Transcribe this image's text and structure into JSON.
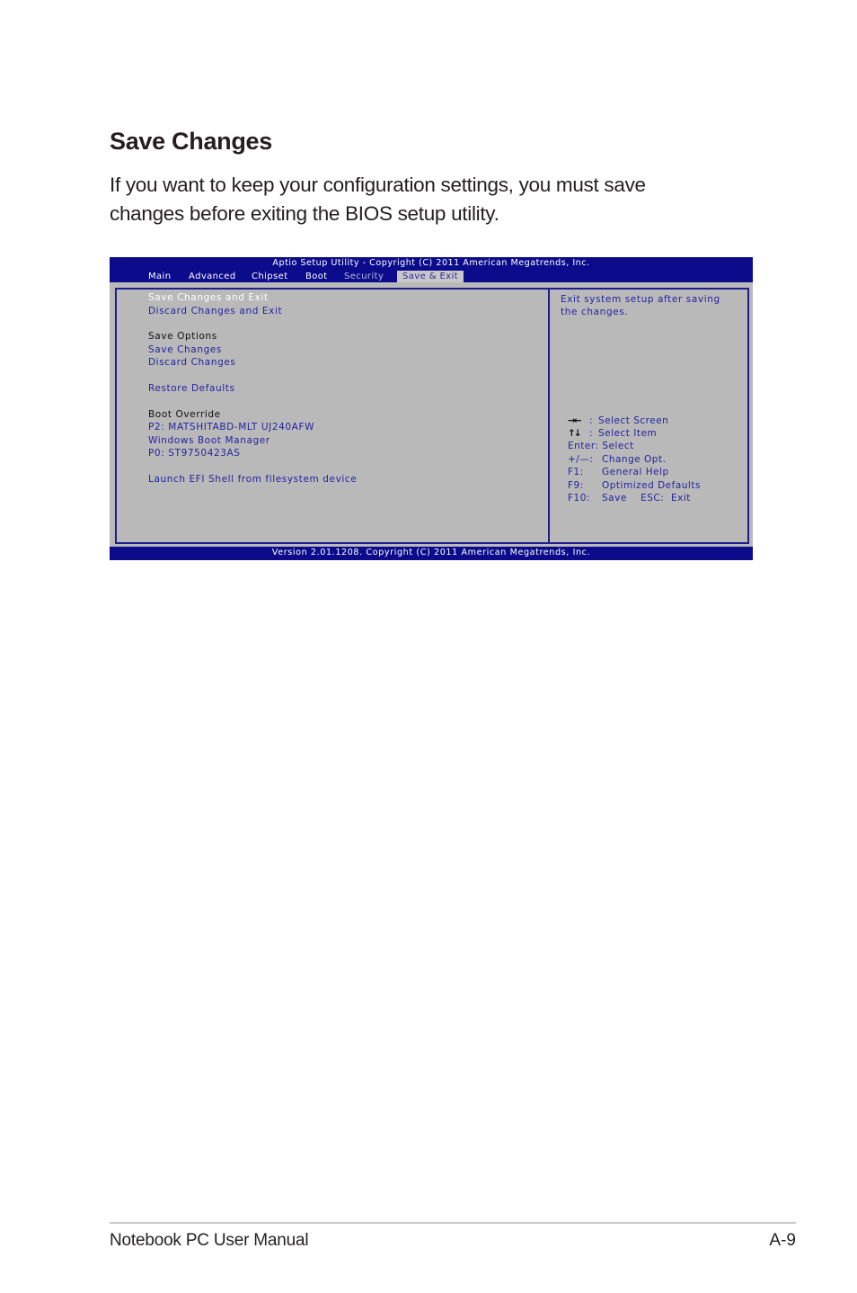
{
  "page": {
    "title": "Save Changes",
    "intro_line1": "If you want to keep your configuration settings, you must save",
    "intro_line2": "changes before exiting the BIOS setup utility."
  },
  "bios": {
    "title": "Aptio Setup Utility - Copyright (C) 2011 American Megatrends, Inc.",
    "tabs": [
      "Main",
      "Advanced",
      "Chipset",
      "Boot",
      "Security",
      "Save & Exit"
    ],
    "active_tab": "Save & Exit",
    "menu": {
      "save_changes_and_exit": "Save Changes and Exit",
      "discard_changes_and_exit": "Discard Changes and Exit",
      "save_options_heading": "Save Options",
      "save_changes": "Save Changes",
      "discard_changes": "Discard Changes",
      "restore_defaults": "Restore Defaults",
      "boot_override_heading": "Boot Override",
      "boot_p2": "P2:  MATSHITABD-MLT UJ240AFW",
      "boot_windows": "Windows Boot Manager",
      "boot_p0": "P0:  ST9750423AS",
      "launch_efi": "Launch EFI Shell from filesystem device"
    },
    "help": {
      "line1": "Exit system setup after saving",
      "line2": "the changes."
    },
    "keys": [
      {
        "key": "→←",
        "action": "Select Screen"
      },
      {
        "key": "↑↓",
        "action": "Select Item"
      },
      {
        "key": "Enter:",
        "action": "Select"
      },
      {
        "key": "+/—:",
        "action": "Change Opt."
      },
      {
        "key": "F1:",
        "action": "General Help"
      },
      {
        "key": "F9:",
        "action": "Optimized Defaults"
      },
      {
        "key": "F10:",
        "action": "Save    ESC:  Exit"
      }
    ],
    "footer": "Version 2.01.1208. Copyright (C) 2011 American Megatrends, Inc."
  },
  "footer": {
    "manual": "Notebook PC User Manual",
    "page_number": "A-9"
  }
}
